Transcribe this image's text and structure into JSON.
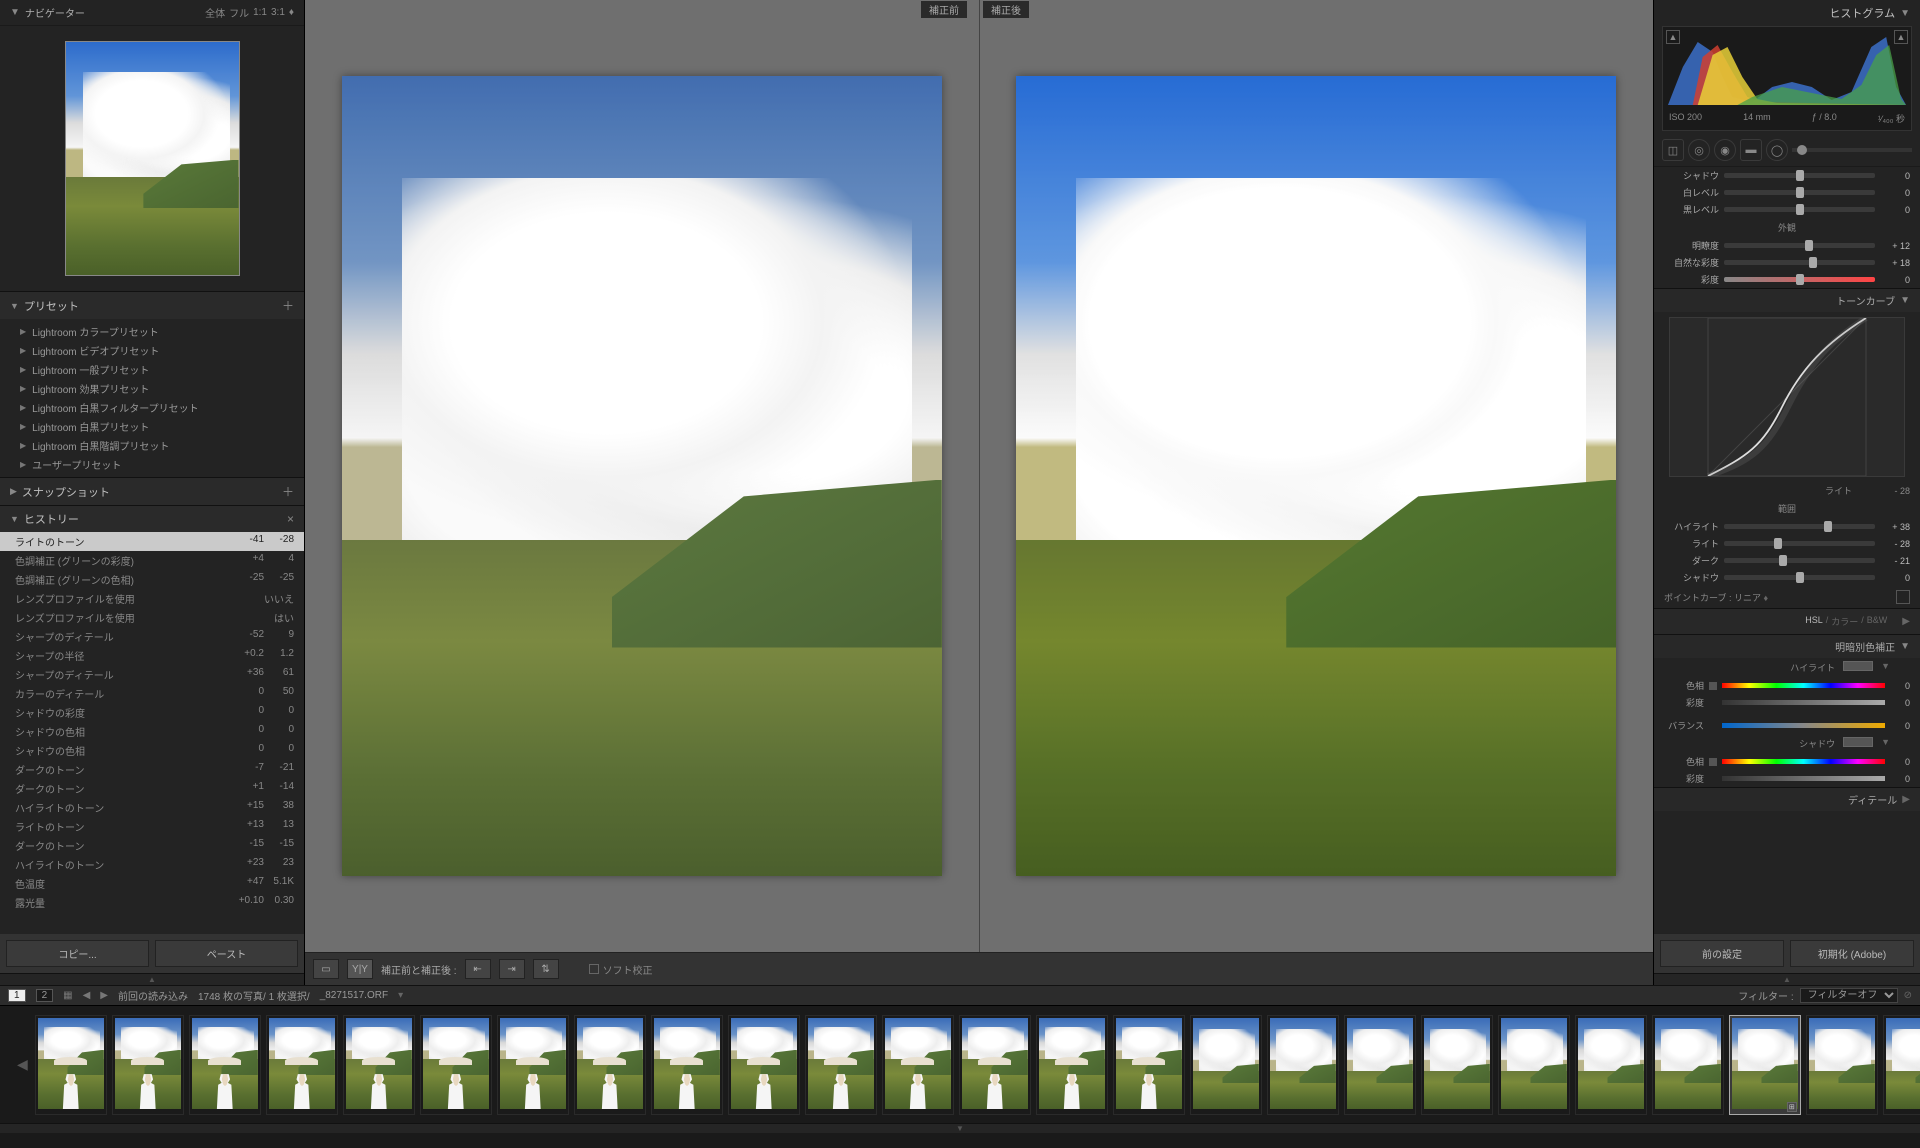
{
  "navigator": {
    "title": "ナビゲーター",
    "zoom_full": "全体",
    "zoom_fill": "フル",
    "zoom_1_1": "1:1",
    "zoom_3_1": "3:1"
  },
  "presets": {
    "title": "プリセット",
    "items": [
      "Lightroom カラープリセット",
      "Lightroom ビデオプリセット",
      "Lightroom 一般プリセット",
      "Lightroom 効果プリセット",
      "Lightroom 白黒フィルタープリセット",
      "Lightroom 白黒プリセット",
      "Lightroom 白黒階調プリセット",
      "ユーザープリセット"
    ]
  },
  "snapshots": {
    "title": "スナップショット"
  },
  "history": {
    "title": "ヒストリー",
    "items": [
      {
        "label": "ライトのトーン",
        "v1": "-41",
        "v2": "-28",
        "selected": true
      },
      {
        "label": "色調補正 (グリーンの彩度)",
        "v1": "+4",
        "v2": "4"
      },
      {
        "label": "色調補正 (グリーンの色相)",
        "v1": "-25",
        "v2": "-25"
      },
      {
        "label": "レンズプロファイルを使用",
        "v1": "",
        "v2": "いいえ"
      },
      {
        "label": "レンズプロファイルを使用",
        "v1": "",
        "v2": "はい"
      },
      {
        "label": "シャープのディテール",
        "v1": "-52",
        "v2": "9"
      },
      {
        "label": "シャープの半径",
        "v1": "+0.2",
        "v2": "1.2"
      },
      {
        "label": "シャープのディテール",
        "v1": "+36",
        "v2": "61"
      },
      {
        "label": "カラーのディテール",
        "v1": "0",
        "v2": "50"
      },
      {
        "label": "シャドウの彩度",
        "v1": "0",
        "v2": "0"
      },
      {
        "label": "シャドウの色相",
        "v1": "0",
        "v2": "0"
      },
      {
        "label": "シャドウの色相",
        "v1": "0",
        "v2": "0"
      },
      {
        "label": "ダークのトーン",
        "v1": "-7",
        "v2": "-21"
      },
      {
        "label": "ダークのトーン",
        "v1": "+1",
        "v2": "-14"
      },
      {
        "label": "ハイライトのトーン",
        "v1": "+15",
        "v2": "38"
      },
      {
        "label": "ライトのトーン",
        "v1": "+13",
        "v2": "13"
      },
      {
        "label": "ダークのトーン",
        "v1": "-15",
        "v2": "-15"
      },
      {
        "label": "ハイライトのトーン",
        "v1": "+23",
        "v2": "23"
      },
      {
        "label": "色温度",
        "v1": "+47",
        "v2": "5.1K"
      },
      {
        "label": "露光量",
        "v1": "+0.10",
        "v2": "0.30"
      }
    ]
  },
  "left_buttons": {
    "copy": "コピー...",
    "paste": "ペースト"
  },
  "compare": {
    "before": "補正前",
    "after": "補正後",
    "toolbar_label": "補正前と補正後 :",
    "soft_proof": "ソフト校正"
  },
  "right": {
    "histogram_title": "ヒストグラム",
    "histo_meta": {
      "iso": "ISO 200",
      "focal": "14 mm",
      "aperture": "ƒ / 8.0",
      "shutter": "¹⁄₄₀₀ 秒"
    },
    "basic": {
      "shadow": {
        "label": "シャドウ",
        "value": "0"
      },
      "white": {
        "label": "白レベル",
        "value": "0"
      },
      "black": {
        "label": "黒レベル",
        "value": "0"
      },
      "presence_title": "外観",
      "clarity": {
        "label": "明瞭度",
        "value": "+ 12"
      },
      "vibrance": {
        "label": "自然な彩度",
        "value": "+ 18"
      },
      "saturation": {
        "label": "彩度",
        "value": "0"
      }
    },
    "tone_curve": {
      "title": "トーンカーブ",
      "region_title": "範囲",
      "region": {
        "label": "ライト",
        "value": "- 28"
      },
      "highlight": {
        "label": "ハイライト",
        "value": "+ 38"
      },
      "light": {
        "label": "ライト",
        "value": "- 28"
      },
      "dark": {
        "label": "ダーク",
        "value": "- 21"
      },
      "shadow": {
        "label": "シャドウ",
        "value": "0"
      },
      "point_curve_label": "ポイントカーブ :",
      "point_curve_value": "リニア"
    },
    "hsl": {
      "title": "HSL",
      "tab2": "カラー",
      "tab3": "B&W"
    },
    "split_tone": {
      "title": "明暗別色補正",
      "highlight_title": "ハイライト",
      "hue": {
        "label": "色相",
        "value": "0"
      },
      "sat": {
        "label": "彩度",
        "value": "0"
      },
      "balance": {
        "label": "バランス",
        "value": "0"
      },
      "shadow_title": "シャドウ",
      "s_hue": {
        "label": "色相",
        "value": "0"
      },
      "s_sat": {
        "label": "彩度",
        "value": "0"
      }
    },
    "detail": {
      "title": "ディテール"
    }
  },
  "right_buttons": {
    "prev": "前の設定",
    "reset": "初期化 (Adobe)"
  },
  "info_bar": {
    "page1": "1",
    "page2": "2",
    "source": "前回の読み込み",
    "count": "1748 枚の写真/ 1 枚選択/",
    "filename": "_8271517.ORF",
    "filter_label": "フィルター :",
    "filter_off": "フィルターオフ"
  }
}
